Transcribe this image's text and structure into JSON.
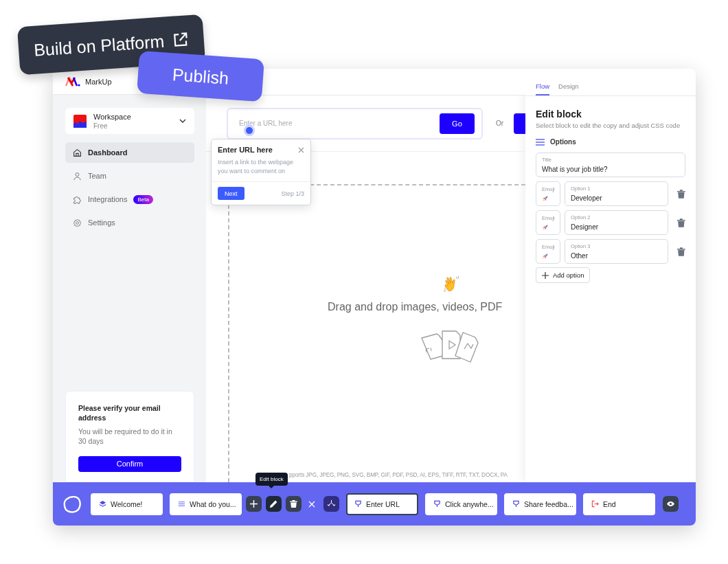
{
  "tags": [
    {
      "kind": "dark",
      "label": "Build on Platform"
    },
    {
      "kind": "accent",
      "label": "Publish"
    }
  ],
  "app": {
    "name": "MarkUp"
  },
  "sidebar": {
    "workspace": {
      "name": "Workspace",
      "plan": "Free"
    },
    "items": [
      {
        "label": "Dashboard",
        "selected": true
      },
      {
        "label": "Team",
        "selected": false
      },
      {
        "label": "Integrations",
        "selected": false,
        "badge": "Beta"
      },
      {
        "label": "Settings",
        "selected": false
      }
    ],
    "notice": {
      "title": "Please verify your email address",
      "body": "You will be required to do it in 30 days",
      "button": "Confirm"
    }
  },
  "url_bar": {
    "placeholder": "Enter a URL here",
    "button": "Go",
    "separator": "Or"
  },
  "tour": {
    "title": "Enter URL here",
    "body": "Insert a link to the webpage you want to comment on",
    "button": "Next",
    "step": "Step 1/3"
  },
  "dropzone": {
    "text": "Drag and drop images, videos, PDF",
    "formats": "pports JPG, JPEG, PNG, SVG, BMP, GIF, PDF, PSD, AI, EPS, TIFF, RTF, TXT, DOCX, PA"
  },
  "panel": {
    "tabs": [
      {
        "label": "Flow",
        "selected": true
      },
      {
        "label": "Design",
        "selected": false
      }
    ],
    "title": "Edit block",
    "subtitle": "Select block to edit the copy and adjust CSS code",
    "section": "Options",
    "title_field": {
      "label": "Title",
      "value": "What is your job title?"
    },
    "options": [
      {
        "emoji_label": "Emoji",
        "label": "Option 1",
        "value": "Developer"
      },
      {
        "emoji_label": "Emoji",
        "label": "Option 2",
        "value": "Designer"
      },
      {
        "emoji_label": "Emoji",
        "label": "Option 3",
        "value": "Other"
      }
    ],
    "add_button": "Add option"
  },
  "toolbar": {
    "tooltip": "Edit block",
    "blocks_before": [
      {
        "label": "Welcome!",
        "selected": false
      },
      {
        "label": "What do you...",
        "selected": false
      }
    ],
    "blocks_after": [
      {
        "label": "Enter URL",
        "selected": true
      },
      {
        "label": "Click anywhe...",
        "selected": false
      },
      {
        "label": "Share feedba...",
        "selected": false
      },
      {
        "label": "End",
        "selected": false
      }
    ]
  }
}
